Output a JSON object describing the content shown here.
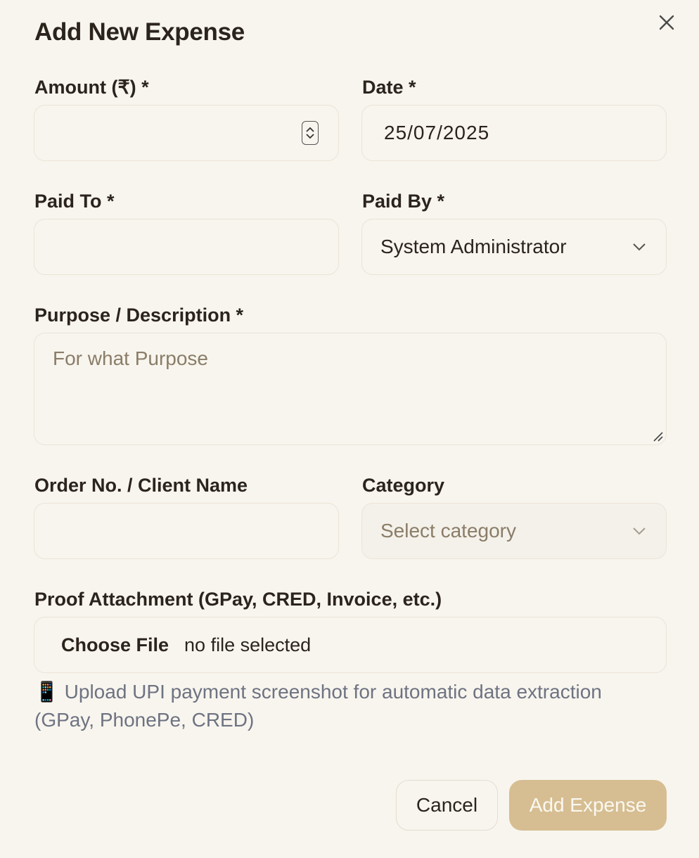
{
  "dialog": {
    "title": "Add New Expense",
    "close_icon": "close-icon"
  },
  "amount": {
    "label": "Amount (₹) *",
    "value": ""
  },
  "date": {
    "label": "Date *",
    "value": "25/07/2025"
  },
  "paid_to": {
    "label": "Paid To *",
    "value": ""
  },
  "paid_by": {
    "label": "Paid By *",
    "selected": "System Administrator"
  },
  "purpose": {
    "label": "Purpose / Description *",
    "placeholder": "For what Purpose"
  },
  "order": {
    "label": "Order No. / Client Name",
    "value": ""
  },
  "category": {
    "label": "Category",
    "placeholder": "Select category"
  },
  "proof": {
    "label": "Proof Attachment (GPay, CRED, Invoice, etc.)",
    "choose_button": "Choose File",
    "status": "no file selected",
    "hint_icon": "📱",
    "hint": "Upload UPI payment screenshot for automatic data extraction (GPay, PhonePe, CRED)"
  },
  "actions": {
    "cancel": "Cancel",
    "submit": "Add Expense"
  },
  "colors": {
    "background": "#f8f5ee",
    "accent": "#d6be92",
    "border": "#ebe4d7",
    "hint": "#6e7382"
  }
}
